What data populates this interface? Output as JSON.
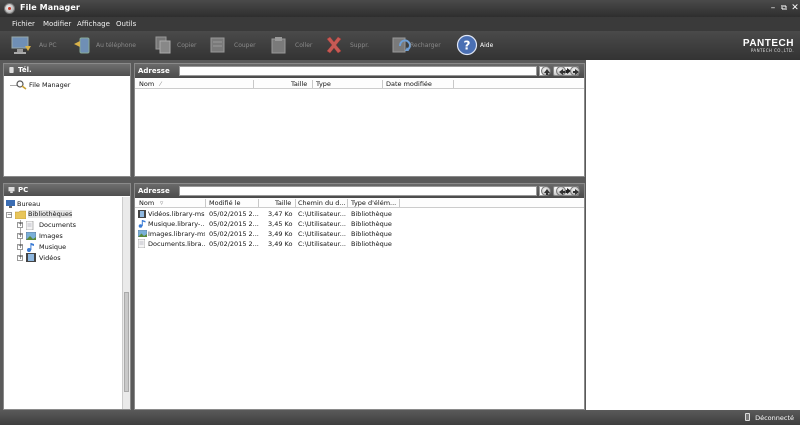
{
  "window": {
    "title": "File Manager"
  },
  "menu": [
    {
      "label": "Fichier"
    },
    {
      "label": "Modifier"
    },
    {
      "label": "Affichage"
    },
    {
      "label": "Outils"
    }
  ],
  "toolbar": {
    "buttons": [
      {
        "label": "Au PC",
        "icon": "monitor-icon",
        "enabled": false
      },
      {
        "label": "Au téléphone",
        "icon": "phone-transfer-icon",
        "enabled": false
      },
      {
        "label": "Copier",
        "icon": "copy-icon",
        "enabled": false
      },
      {
        "label": "Couper",
        "icon": "cut-icon",
        "enabled": false
      },
      {
        "label": "Coller",
        "icon": "paste-icon",
        "enabled": false
      },
      {
        "label": "Suppr.",
        "icon": "delete-icon",
        "enabled": false
      },
      {
        "label": "Recharger",
        "icon": "refresh-icon",
        "enabled": false
      },
      {
        "label": "Aide",
        "icon": "help-icon",
        "enabled": true
      }
    ],
    "brand": {
      "name": "PANTECH",
      "sub": "PANTECH CO.,LTD."
    }
  },
  "phone_tree": {
    "header": "Tél.",
    "items": [
      {
        "label": "File Manager"
      }
    ]
  },
  "pc_tree": {
    "header": "PC",
    "root": "Bureau",
    "library": "Bibliothèques",
    "children": [
      {
        "label": "Documents"
      },
      {
        "label": "Images"
      },
      {
        "label": "Musique"
      },
      {
        "label": "Vidéos"
      }
    ]
  },
  "phone_list": {
    "address_label": "Adresse",
    "address_value": "",
    "columns": [
      "Nom",
      "Taille",
      "Type",
      "Date modifiée"
    ],
    "rows": []
  },
  "pc_list": {
    "address_label": "Adresse",
    "address_value": "",
    "columns": [
      "Nom",
      "Modifié le",
      "Taille",
      "Chemin du d...",
      "Type d'élém..."
    ],
    "rows": [
      {
        "name": "Vidéos.library-ms",
        "modified": "05/02/2015 2...",
        "size": "3,47 Ko",
        "path": "C:\\Utilisateur...",
        "type": "Bibliothèque"
      },
      {
        "name": "Musique.library-...",
        "modified": "05/02/2015 2...",
        "size": "3,45 Ko",
        "path": "C:\\Utilisateur...",
        "type": "Bibliothèque"
      },
      {
        "name": "Images.library-ms",
        "modified": "05/02/2015 2...",
        "size": "3,49 Ko",
        "path": "C:\\Utilisateur...",
        "type": "Bibliothèque"
      },
      {
        "name": "Documents.libra...",
        "modified": "05/02/2015 2...",
        "size": "3,49 Ko",
        "path": "C:\\Utilisateur...",
        "type": "Bibliothèque"
      }
    ]
  },
  "status": {
    "text": "Déconnecté"
  },
  "colors": {
    "chrome_dark": "#3a3a3a",
    "pane_header": "#5a5a5a",
    "delete_red": "#d9534f",
    "help_blue": "#4a6fb3"
  }
}
